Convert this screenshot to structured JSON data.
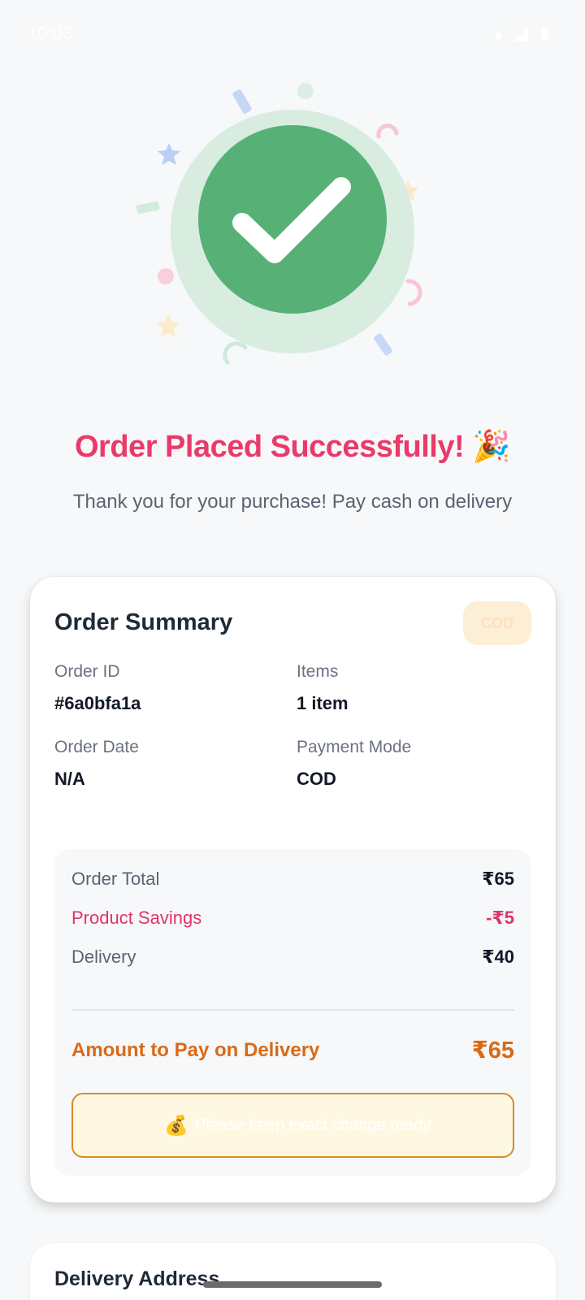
{
  "status_bar": {
    "time": "10:03",
    "system_icons": "▴ ◢ ▮"
  },
  "hero": {
    "title": "Order Placed Successfully!",
    "title_emoji": "🎉",
    "subtitle": "Thank you for your purchase! Pay cash on delivery",
    "colors": {
      "check_green": "#57b177",
      "halo": "#d9ece0",
      "title_pink": "#ea3a6a"
    }
  },
  "order_summary": {
    "title": "Order Summary",
    "badge": "COD",
    "fields": {
      "order_id": {
        "label": "Order ID",
        "value": "#6a0bfa1a"
      },
      "items": {
        "label": "Items",
        "value": "1 item"
      },
      "order_date": {
        "label": "Order Date",
        "value": "N/A"
      },
      "payment_mode": {
        "label": "Payment Mode",
        "value": "COD"
      }
    },
    "totals": {
      "order_total": {
        "label": "Order Total",
        "amount": "₹65"
      },
      "product_savings": {
        "label": "Product Savings",
        "amount": "-₹5"
      },
      "delivery": {
        "label": "Delivery",
        "amount": "₹40"
      },
      "amount_to_pay": {
        "label": "Amount to Pay on Delivery",
        "amount": "₹65"
      }
    },
    "note": {
      "icon": "money-bag-icon",
      "emoji": "💰",
      "text": "Please keep exact change ready"
    }
  },
  "delivery_address": {
    "title": "Delivery Address"
  }
}
